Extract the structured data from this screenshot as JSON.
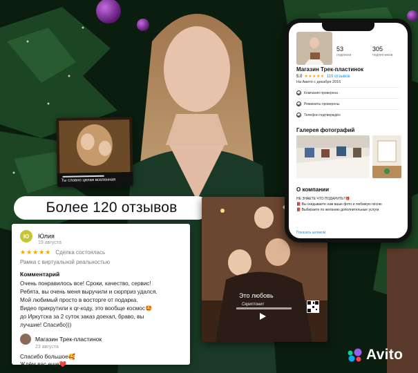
{
  "badge": {
    "text": "Более 120 отзывов"
  },
  "review": {
    "avatar_initials": "Ю",
    "author": "Юлия",
    "date": "19 августа",
    "stars": "★★★★★",
    "status": "Сделка состоялась",
    "product": "Рамка с виртуальной реальностью",
    "comment_title": "Комментарий",
    "comment_lines": [
      "Очень понравилось все! Сроки, качество, сервис!",
      "Ребята, вы очень меня выручили и сюрприз удался.",
      "Мой любимый просто в восторге от подарка.",
      "Видео прикрутили к qr-коду, это вообще космос🤩",
      "до Иркутска за 2 суток заказ доехал, браво, вы",
      "лучшие! Спасибо)))"
    ],
    "reply": {
      "author": "Магазин Трек-пластинок",
      "date": "23 августа",
      "line1": "Спасибо большое🥰",
      "line2": "Ждём вас еще❤️"
    }
  },
  "plaque_small": {
    "caption": "Ты словно целая вселенная"
  },
  "plaque_big": {
    "title": "Это любовь",
    "subtitle": "Скриптонит"
  },
  "phone": {
    "subscribers_count": "53",
    "subscribers_label": "подписки",
    "followers_count": "305",
    "followers_label": "подписчиков",
    "shop_name": "Магазин Трек-пластинок",
    "rating": "5.0",
    "stars": "★★★★★",
    "reviews_count": "119 отзывов",
    "since": "На Авито с декабря 2016",
    "checks": [
      "Компания проверена",
      "Реквизиты проверены",
      "Телефон подтверждён"
    ],
    "gallery_title": "Галерея фотографий",
    "about_title": "О компании",
    "about_lines": [
      "НЕ ЗНАЕТЕ ЧТО ПОДАРИТЬ?🎁",
      "📕 Вы скидываете нам ваше фото и любимую песню",
      "📕 Выбираете по желанию дополнительные услуги"
    ],
    "about_link": "Показать целиком"
  },
  "logo": {
    "text": "Avito"
  },
  "colors": {
    "star": "#f7a600",
    "link": "#0099f7",
    "avatar": "#c7c535",
    "logo_purple": "#965eeb",
    "logo_green": "#00d68f",
    "logo_blue": "#0aa7ff",
    "logo_red": "#ff4053"
  }
}
